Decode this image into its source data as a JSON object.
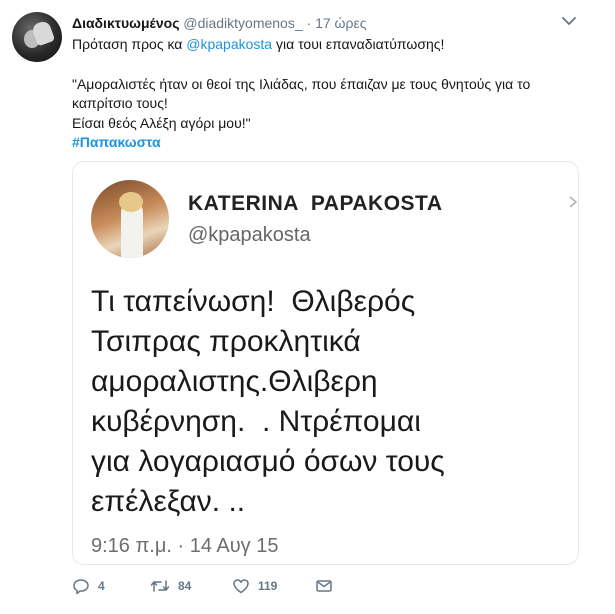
{
  "tweet": {
    "author_name": "Διαδικτυωμένος",
    "author_handle": "@diadiktyomenos_",
    "separator": "·",
    "time": "17 ώρες",
    "text_prefix": "Πρόταση προς κα ",
    "mention": "@kpapakosta",
    "text_suffix": " για τουι επαναδιατύπωσης!",
    "quote_line1": "\"Αμοραλιστές ήταν οι θεοί της Ιλιάδας, που έπαιζαν με τους θνητούς για το",
    "quote_line2": "καπρίτσιο τους!",
    "quote_line3": "Είσαι θεός Αλέξη αγόρι μου!\"",
    "hashtag": "#Παπακωστα",
    "icons": {
      "menu": "chevron-down-icon"
    }
  },
  "quoted_card": {
    "name": "KATERINA  PAPAKOSTA",
    "handle": "@kpapakosta",
    "lines": [
      "Τι ταπείνωση!  Θλιβερός",
      "Τσιπρας προκλητικά",
      "αμοραλιστης.Θλιβερη",
      "κυβέρνηση.  . Ντρέπομαι",
      "για λογαριασμό όσων τους",
      "επέλεξαν. .."
    ],
    "date": "9:16 π.μ. · 14 Αυγ 15"
  },
  "actions": {
    "reply_count": "4",
    "retweet_count": "84",
    "like_count": "119",
    "icons": [
      "reply-icon",
      "retweet-icon",
      "like-icon",
      "direct-message-icon"
    ]
  },
  "colors": {
    "link": "#1b95e0",
    "muted": "#657786",
    "text": "#14171a"
  }
}
